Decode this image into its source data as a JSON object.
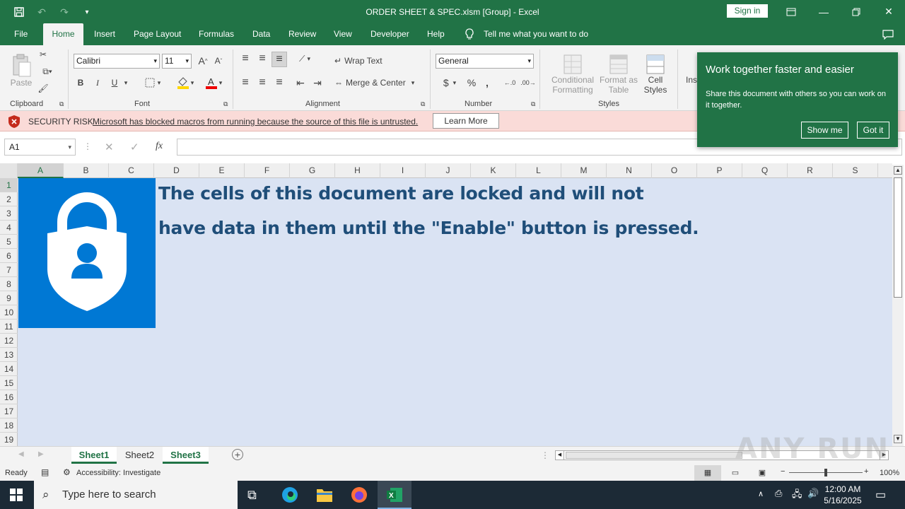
{
  "window": {
    "title": "ORDER SHEET & SPEC.xlsm  [Group]  -  Excel",
    "sign_in": "Sign in"
  },
  "tabs": [
    "File",
    "Home",
    "Insert",
    "Page Layout",
    "Formulas",
    "Data",
    "Review",
    "View",
    "Developer",
    "Help"
  ],
  "tell_me": "Tell me what you want to do",
  "ribbon": {
    "paste": "Paste",
    "font_name": "Calibri",
    "font_size": "11",
    "bold": "B",
    "italic": "I",
    "underline": "U",
    "wrap_text": "Wrap Text",
    "merge_center": "Merge & Center",
    "number_format": "General",
    "currency": "$",
    "percent": "%",
    "comma": ",",
    "conditional_formatting": [
      "Conditional",
      "Formatting"
    ],
    "format_as_table": [
      "Format as",
      "Table"
    ],
    "cell_styles": [
      "Cell",
      "Styles"
    ],
    "insert_partial": "Ins",
    "groups": {
      "clipboard": "Clipboard",
      "font": "Font",
      "alignment": "Alignment",
      "number": "Number",
      "styles": "Styles"
    }
  },
  "security_bar": {
    "label": "SECURITY RISK",
    "message": "Microsoft has blocked macros from running because the source of this file is untrusted.",
    "button": "Learn More"
  },
  "formula_bar": {
    "name_box": "A1",
    "fx": "fx",
    "content": ""
  },
  "columns": [
    "A",
    "B",
    "C",
    "D",
    "E",
    "F",
    "G",
    "H",
    "I",
    "J",
    "K",
    "L",
    "M",
    "N",
    "O",
    "P",
    "Q",
    "R",
    "S"
  ],
  "rows": [
    "1",
    "2",
    "3",
    "4",
    "5",
    "6",
    "7",
    "8",
    "9",
    "10",
    "11",
    "12",
    "13",
    "14",
    "15",
    "16",
    "17",
    "18",
    "19"
  ],
  "sheet_content": {
    "line1": "The cells of this document are locked and will not",
    "line2": "have data in them until the \"Enable\" button is pressed."
  },
  "sheets": [
    "Sheet1",
    "Sheet2",
    "Sheet3"
  ],
  "status": {
    "ready": "Ready",
    "accessibility": "Accessibility: Investigate",
    "zoom": "100%"
  },
  "toast": {
    "title": "Work together faster and easier",
    "body": "Share this document with others so you can work on it together.",
    "show_me": "Show me",
    "got_it": "Got it"
  },
  "taskbar": {
    "search_placeholder": "Type here to search",
    "time": "12:00 AM",
    "date": "5/16/2025"
  },
  "watermark": "ANY RUN",
  "colors": {
    "excel_green": "#217346",
    "sheet_fill": "#dae3f3",
    "lock_blue": "#0078d4",
    "text_blue": "#1f4e79",
    "security_bar": "#fadbd8"
  }
}
